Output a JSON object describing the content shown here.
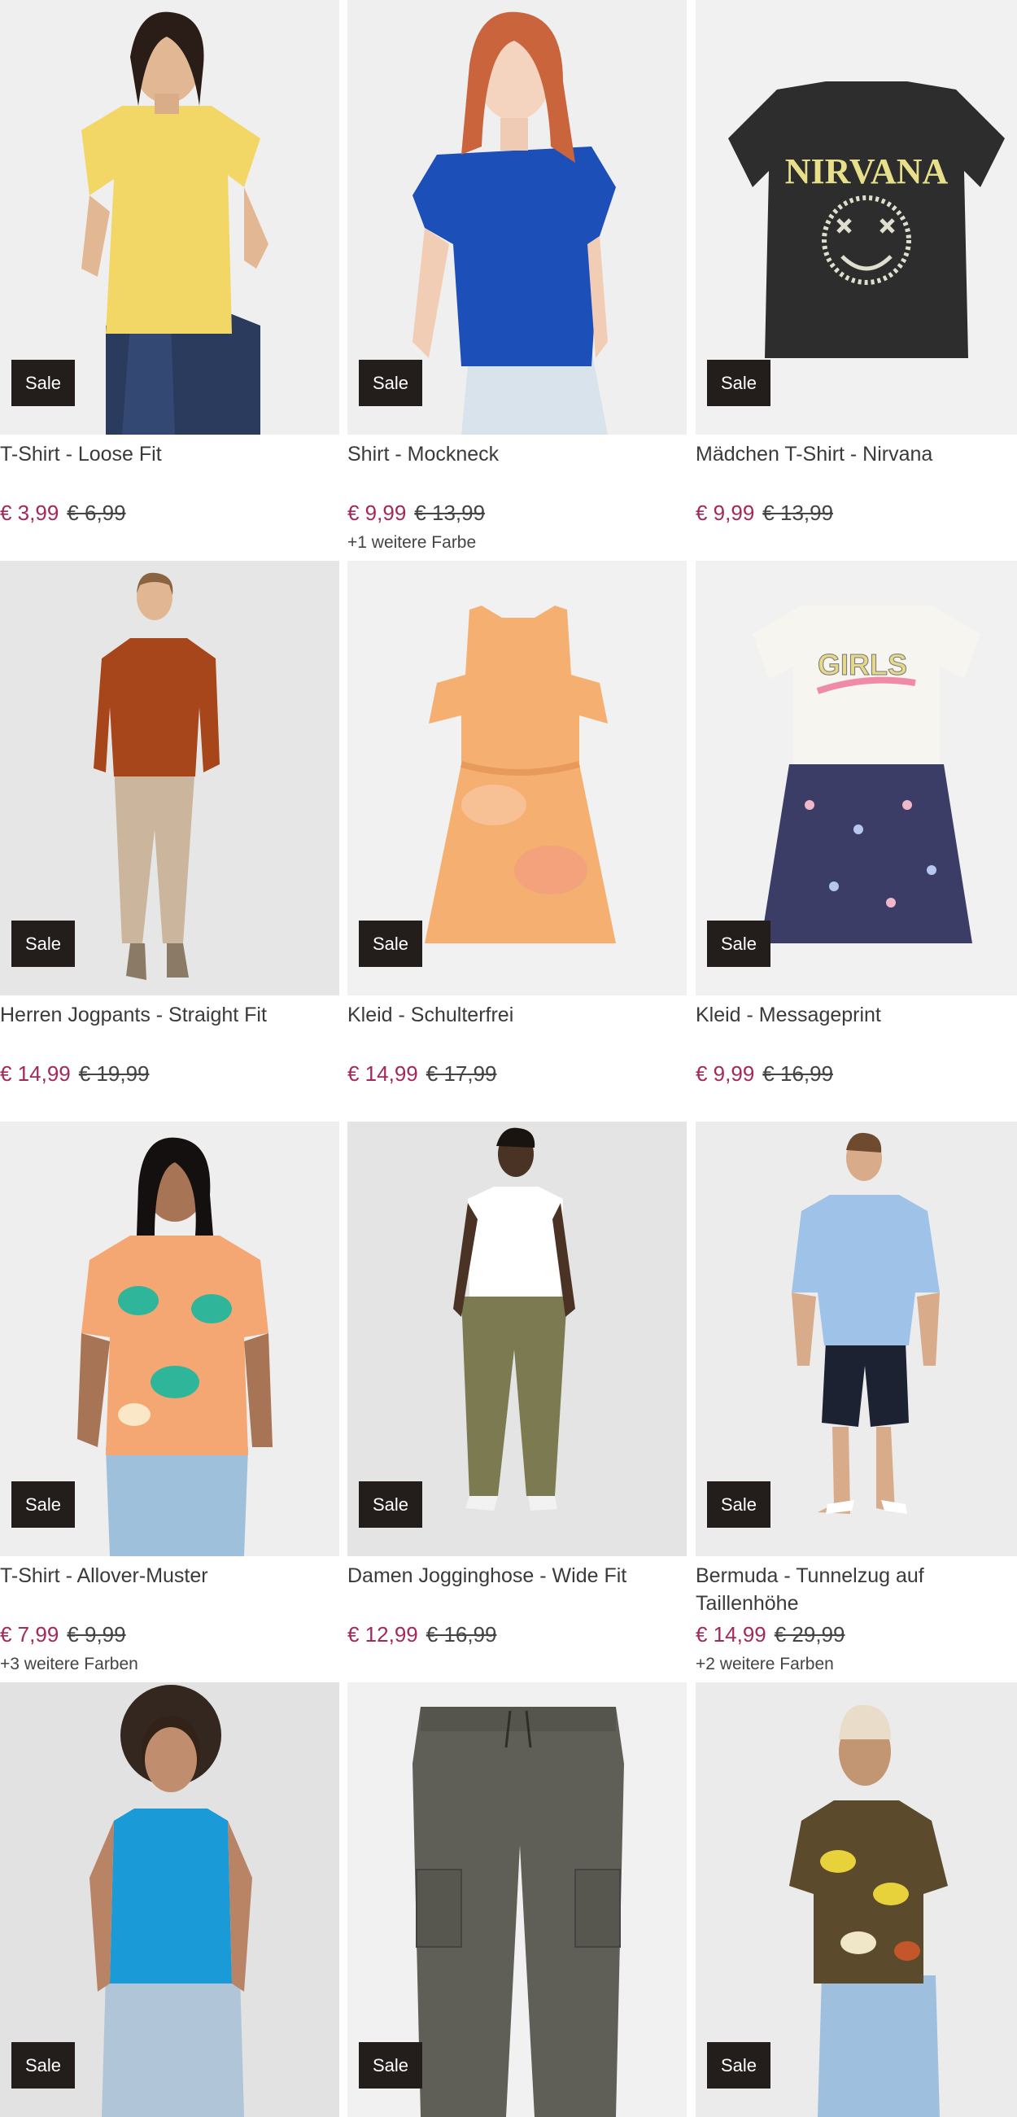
{
  "sale_badge_label": "Sale",
  "currency": "€",
  "colors": {
    "sale_price": "#a3295a",
    "badge_bg": "#231d1b",
    "text": "#3a3a3a"
  },
  "products": [
    {
      "title": "T-Shirt - Loose Fit",
      "price": "€ 3,99",
      "old_price": "€ 6,99",
      "more_colors": "",
      "image": "woman-yellow-tshirt",
      "bg": "#efefef"
    },
    {
      "title": "Shirt - Mockneck",
      "price": "€ 9,99",
      "old_price": "€ 13,99",
      "more_colors": "+1 weitere Farbe",
      "image": "woman-blue-mockneck",
      "bg": "#efefef"
    },
    {
      "title": "Mädchen T-Shirt - Nirvana",
      "price": "€ 9,99",
      "old_price": "€ 13,99",
      "more_colors": "",
      "image": "nirvana-tshirt",
      "bg": "#f1f1f1"
    },
    {
      "title": "Herren Jogpants - Straight Fit",
      "price": "€ 14,99",
      "old_price": "€ 19,99",
      "more_colors": "",
      "image": "man-jogpants",
      "bg": "#e6e6e6"
    },
    {
      "title": "Kleid - Schulterfrei",
      "price": "€ 14,99",
      "old_price": "€ 17,99",
      "more_colors": "",
      "image": "orange-dress",
      "bg": "#f1f1f1"
    },
    {
      "title": "Kleid - Messageprint",
      "price": "€ 9,99",
      "old_price": "€ 16,99",
      "more_colors": "",
      "image": "girls-dress",
      "bg": "#f1f1f1"
    },
    {
      "title": "T-Shirt - Allover-Muster",
      "price": "€ 7,99",
      "old_price": "€ 9,99",
      "more_colors": "+3 weitere Farben",
      "image": "woman-pattern-tshirt",
      "bg": "#eeeeee"
    },
    {
      "title": "Damen Jogginghose - Wide Fit",
      "price": "€ 12,99",
      "old_price": "€ 16,99",
      "more_colors": "",
      "image": "woman-olive-pants",
      "bg": "#e4e4e4"
    },
    {
      "title": "Bermuda - Tunnelzug auf Taillenhöhe",
      "price": "€ 14,99",
      "old_price": "€ 29,99",
      "more_colors": "+2 weitere Farben",
      "image": "man-bermuda",
      "bg": "#ececec"
    },
    {
      "title": "",
      "price": "",
      "old_price": "",
      "more_colors": "",
      "image": "woman-blue-tank",
      "bg": "#e2e2e2"
    },
    {
      "title": "",
      "price": "",
      "old_price": "",
      "more_colors": "",
      "image": "cargo-pants",
      "bg": "#f1f1f1"
    },
    {
      "title": "",
      "price": "",
      "old_price": "",
      "more_colors": "",
      "image": "woman-floral-shirt",
      "bg": "#ebebeb"
    }
  ]
}
